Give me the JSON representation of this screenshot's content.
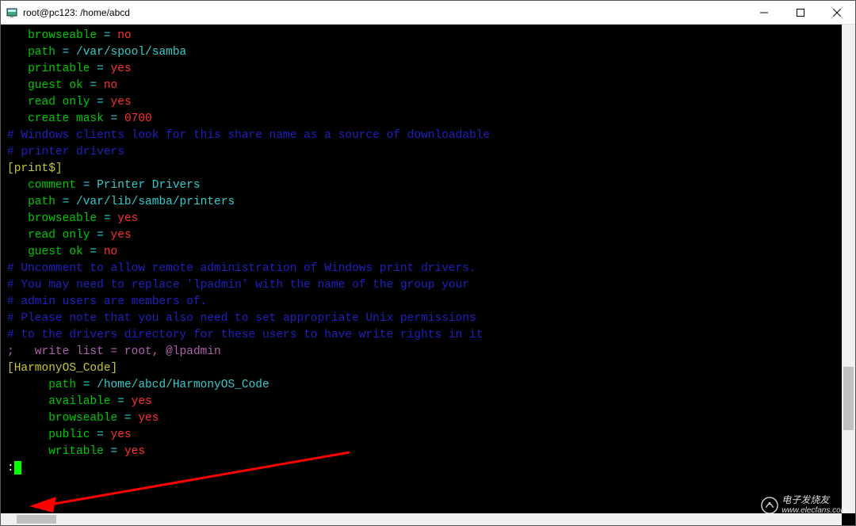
{
  "window": {
    "title": "root@pc123: /home/abcd"
  },
  "terminal": {
    "lines": [
      {
        "indent": "   ",
        "segments": [
          {
            "c": "green",
            "t": "browseable"
          },
          {
            "c": "cyan",
            "t": " = "
          },
          {
            "c": "red",
            "t": "no"
          }
        ]
      },
      {
        "indent": "   ",
        "segments": [
          {
            "c": "green",
            "t": "path"
          },
          {
            "c": "cyan",
            "t": " = /var/spool/samba"
          }
        ]
      },
      {
        "indent": "   ",
        "segments": [
          {
            "c": "green",
            "t": "printable"
          },
          {
            "c": "cyan",
            "t": " = "
          },
          {
            "c": "red",
            "t": "yes"
          }
        ]
      },
      {
        "indent": "   ",
        "segments": [
          {
            "c": "green",
            "t": "guest ok"
          },
          {
            "c": "cyan",
            "t": " = "
          },
          {
            "c": "red",
            "t": "no"
          }
        ]
      },
      {
        "indent": "   ",
        "segments": [
          {
            "c": "green",
            "t": "read only"
          },
          {
            "c": "cyan",
            "t": " = "
          },
          {
            "c": "red",
            "t": "yes"
          }
        ]
      },
      {
        "indent": "   ",
        "segments": [
          {
            "c": "green",
            "t": "create mask"
          },
          {
            "c": "cyan",
            "t": " = "
          },
          {
            "c": "red",
            "t": "0700"
          }
        ]
      },
      {
        "indent": "",
        "segments": []
      },
      {
        "indent": "",
        "segments": [
          {
            "c": "blue",
            "t": "# Windows clients look for this share name as a source of downloadable"
          }
        ]
      },
      {
        "indent": "",
        "segments": [
          {
            "c": "blue",
            "t": "# printer drivers"
          }
        ]
      },
      {
        "indent": "",
        "segments": [
          {
            "c": "yellow",
            "t": "[print$]"
          }
        ]
      },
      {
        "indent": "   ",
        "segments": [
          {
            "c": "green",
            "t": "comment"
          },
          {
            "c": "cyan",
            "t": " = Printer Drivers"
          }
        ]
      },
      {
        "indent": "   ",
        "segments": [
          {
            "c": "green",
            "t": "path"
          },
          {
            "c": "cyan",
            "t": " = /var/lib/samba/printers"
          }
        ]
      },
      {
        "indent": "   ",
        "segments": [
          {
            "c": "green",
            "t": "browseable"
          },
          {
            "c": "cyan",
            "t": " = "
          },
          {
            "c": "red",
            "t": "yes"
          }
        ]
      },
      {
        "indent": "   ",
        "segments": [
          {
            "c": "green",
            "t": "read only"
          },
          {
            "c": "cyan",
            "t": " = "
          },
          {
            "c": "red",
            "t": "yes"
          }
        ]
      },
      {
        "indent": "   ",
        "segments": [
          {
            "c": "green",
            "t": "guest ok"
          },
          {
            "c": "cyan",
            "t": " = "
          },
          {
            "c": "red",
            "t": "no"
          }
        ]
      },
      {
        "indent": "",
        "segments": [
          {
            "c": "blue",
            "t": "# Uncomment to allow remote administration of Windows print drivers."
          }
        ]
      },
      {
        "indent": "",
        "segments": [
          {
            "c": "blue",
            "t": "# You may need to replace 'lpadmin' with the name of the group your"
          }
        ]
      },
      {
        "indent": "",
        "segments": [
          {
            "c": "blue",
            "t": "# admin users are members of."
          }
        ]
      },
      {
        "indent": "",
        "segments": [
          {
            "c": "blue",
            "t": "# Please note that you also need to set appropriate Unix permissions"
          }
        ]
      },
      {
        "indent": "",
        "segments": [
          {
            "c": "blue",
            "t": "# to the drivers directory for these users to have write rights in it"
          }
        ]
      },
      {
        "indent": "",
        "segments": [
          {
            "c": "purple",
            "t": ";   write list = root, @lpadmin"
          }
        ]
      },
      {
        "indent": "",
        "segments": [
          {
            "c": "yellow",
            "t": "[HarmonyOS_Code]"
          }
        ]
      },
      {
        "indent": "      ",
        "segments": [
          {
            "c": "green",
            "t": "path"
          },
          {
            "c": "cyan",
            "t": " = /home/abcd/HarmonyOS_Code"
          }
        ]
      },
      {
        "indent": "      ",
        "segments": [
          {
            "c": "green",
            "t": "available"
          },
          {
            "c": "cyan",
            "t": " = "
          },
          {
            "c": "red",
            "t": "yes"
          }
        ]
      },
      {
        "indent": "      ",
        "segments": [
          {
            "c": "green",
            "t": "browseable"
          },
          {
            "c": "cyan",
            "t": " = "
          },
          {
            "c": "red",
            "t": "yes"
          }
        ]
      },
      {
        "indent": "      ",
        "segments": [
          {
            "c": "green",
            "t": "public"
          },
          {
            "c": "cyan",
            "t": " = "
          },
          {
            "c": "red",
            "t": "yes"
          }
        ]
      },
      {
        "indent": "      ",
        "segments": [
          {
            "c": "green",
            "t": "writable"
          },
          {
            "c": "cyan",
            "t": " = "
          },
          {
            "c": "red",
            "t": "yes"
          }
        ]
      }
    ],
    "prompt_char": ":"
  },
  "watermark": {
    "line1": "电子发烧友",
    "line2": "www.elecfans.com"
  }
}
